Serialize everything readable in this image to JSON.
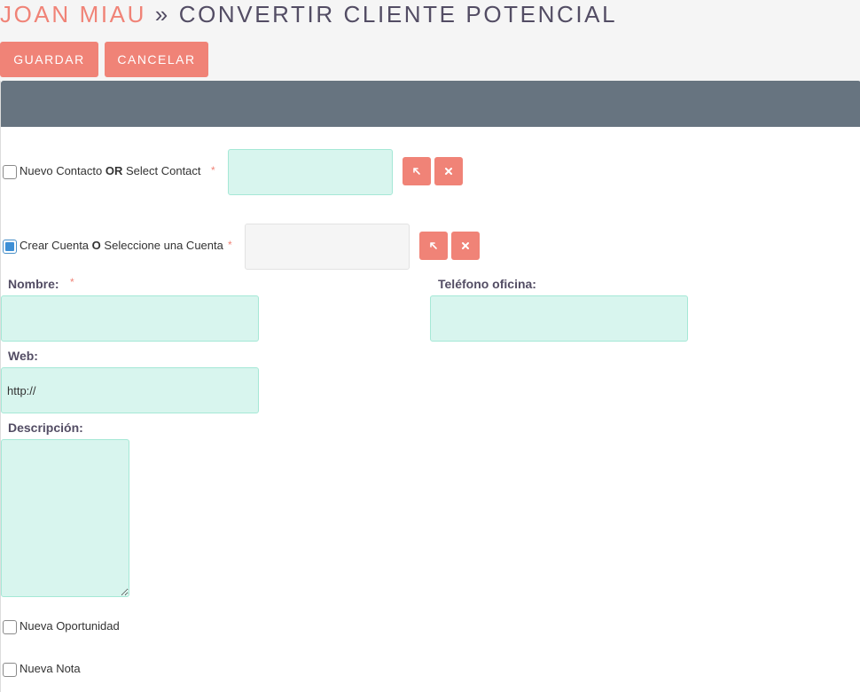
{
  "header": {
    "record_name": "JOAN MIAU",
    "separator": "»",
    "action": "CONVERTIR CLIENTE POTENCIAL"
  },
  "toolbar": {
    "save_label": "GUARDAR",
    "cancel_label": "CANCELAR"
  },
  "contact": {
    "checked": false,
    "label_pre": "Nuevo Contacto",
    "label_or": "OR",
    "label_post": "Select Contact",
    "required_mark": "*",
    "value": "",
    "select_icon": "arrow-up-left-icon",
    "clear_icon": "x-icon"
  },
  "account": {
    "checked": true,
    "label_pre": "Crear Cuenta",
    "label_or": "O",
    "label_post": "Seleccione una Cuenta",
    "required_mark": "*",
    "value": "",
    "select_icon": "arrow-up-left-icon",
    "clear_icon": "x-icon"
  },
  "fields": {
    "name_label": "Nombre:",
    "name_required": "*",
    "name_value": "",
    "phone_label": "Teléfono oficina:",
    "phone_value": "",
    "web_label": "Web:",
    "web_value": "http://",
    "description_label": "Descripción:",
    "description_value": ""
  },
  "options": {
    "opportunity_label": "Nueva Oportunidad",
    "opportunity_checked": false,
    "note_label": "Nueva Nota",
    "note_checked": false
  },
  "colors": {
    "accent": "#f08377",
    "panel_header": "#677480",
    "input_bg": "#d8f5ee",
    "checkbox_checked": "#3d8fd6"
  }
}
